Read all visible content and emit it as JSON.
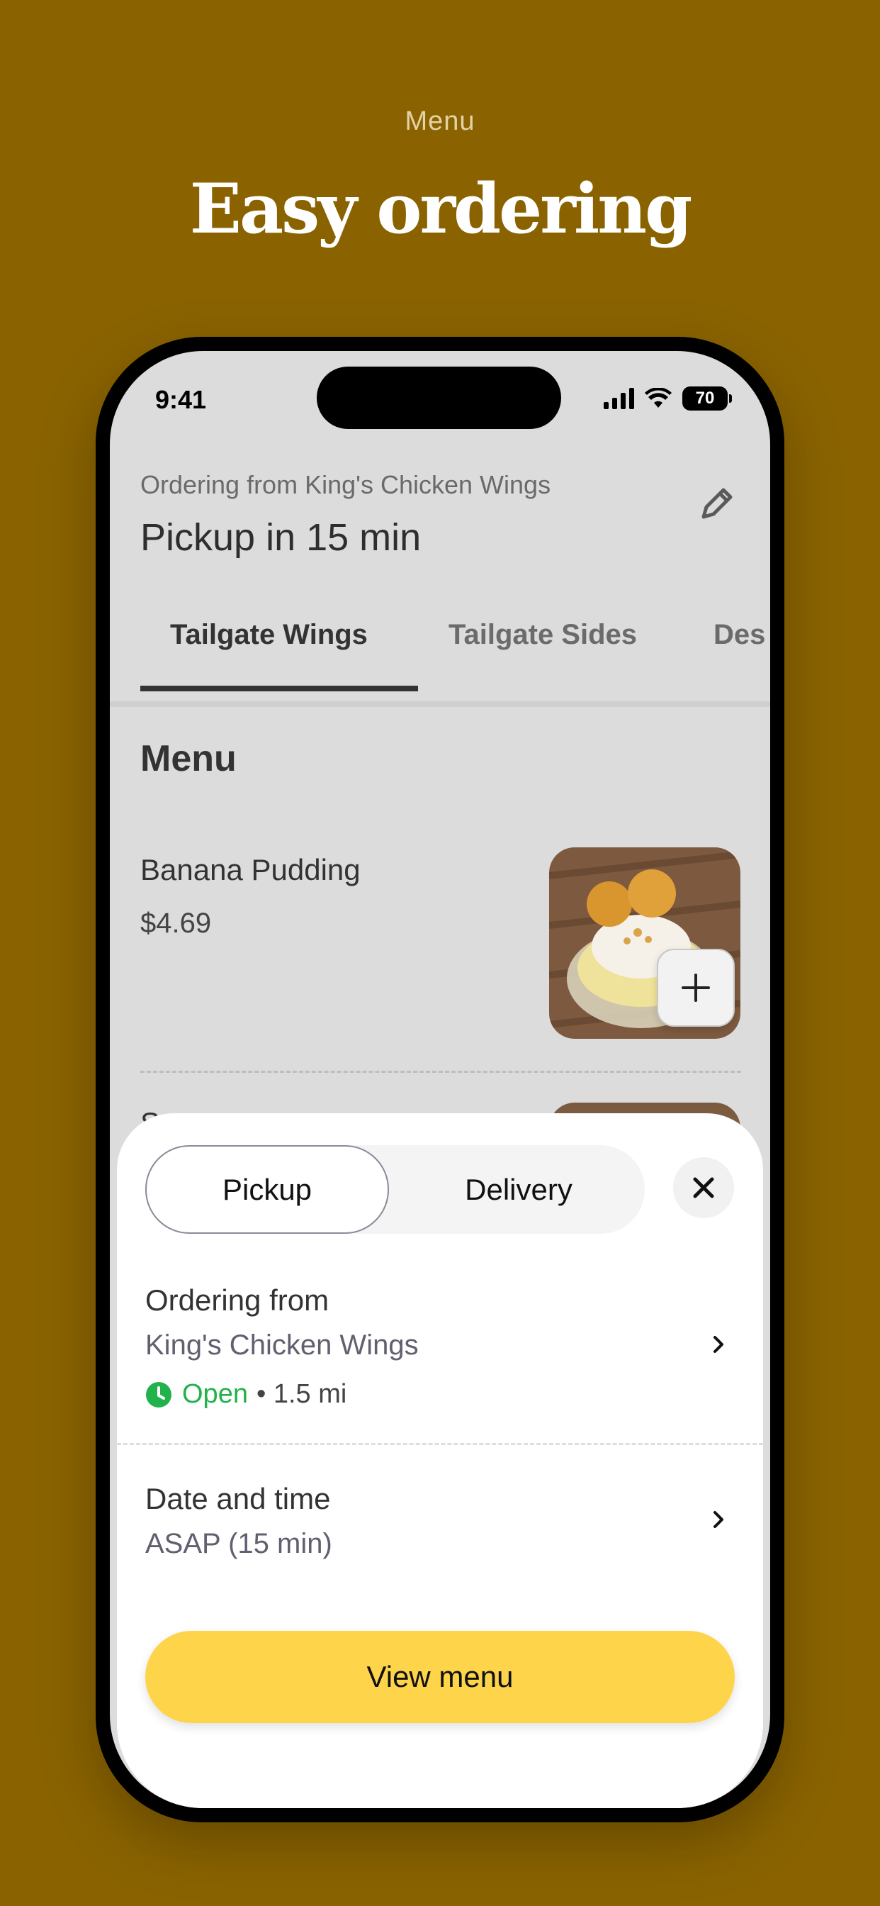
{
  "page": {
    "eyebrow": "Menu",
    "headline": "Easy ordering"
  },
  "status_bar": {
    "time": "9:41",
    "battery": "70"
  },
  "header": {
    "ordering_from": "Ordering from King's Chicken Wings",
    "title": "Pickup in 15 min",
    "edit_icon": "pencil-icon"
  },
  "tabs": [
    {
      "label": "Tailgate Wings",
      "active": true
    },
    {
      "label": "Tailgate Sides",
      "active": false
    },
    {
      "label": "Des",
      "active": false
    }
  ],
  "menu": {
    "section_title": "Menu",
    "items": [
      {
        "name": "Banana Pudding",
        "price": "$4.69",
        "add_icon": "plus-icon"
      }
    ],
    "peek_item_partial": "S"
  },
  "sheet": {
    "mode_options": [
      "Pickup",
      "Delivery"
    ],
    "selected_mode": "Pickup",
    "close_icon": "close-icon",
    "ordering_from": {
      "label": "Ordering from",
      "store": "King's Chicken Wings",
      "status": "Open",
      "distance": "• 1.5 mi"
    },
    "date_time": {
      "label": "Date and time",
      "value": "ASAP (15 min)"
    },
    "cta": "View menu"
  },
  "colors": {
    "background": "#8a6300",
    "accent_yellow": "#fdd44a",
    "open_green": "#21b24b"
  }
}
